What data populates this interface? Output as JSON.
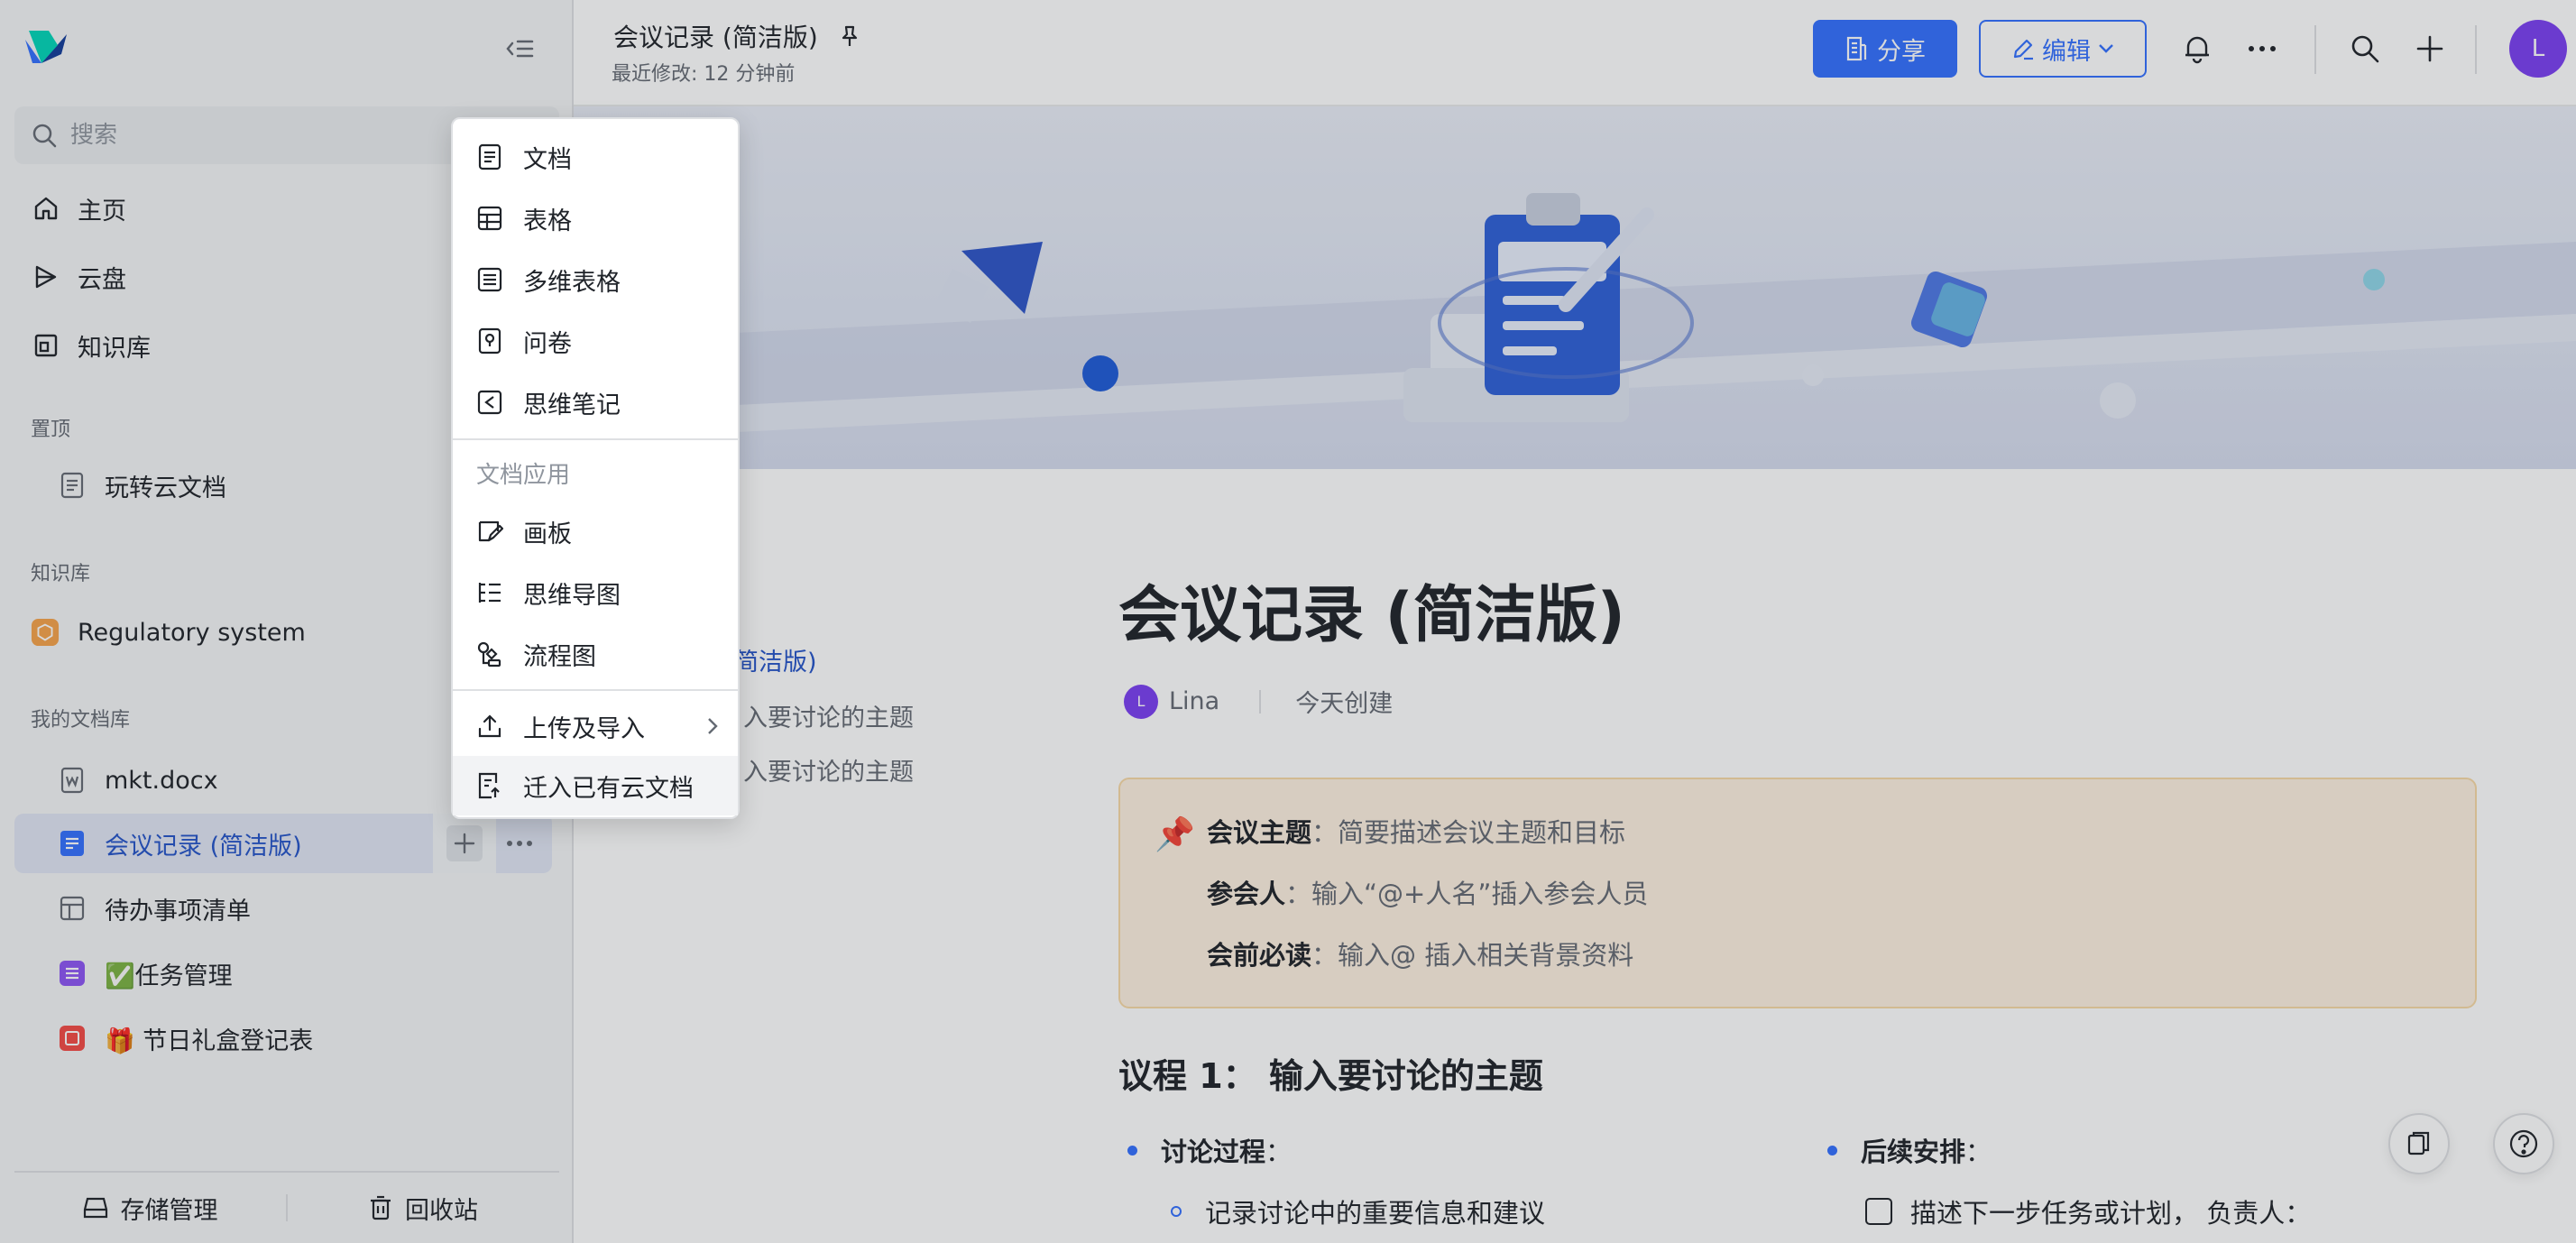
{
  "sidebar": {
    "search_placeholder": "搜索",
    "nav": [
      {
        "label": "主页",
        "icon": "home-icon"
      },
      {
        "label": "云盘",
        "icon": "cloud-drive-icon"
      },
      {
        "label": "知识库",
        "icon": "knowledge-base-icon"
      }
    ],
    "sections": {
      "pinned": "置顶",
      "knowledge": "知识库",
      "my_library": "我的文档库"
    },
    "pinned_items": [
      {
        "label": "玩转云文档",
        "icon": "doc-icon"
      }
    ],
    "knowledge_items": [
      {
        "label": "Regulatory system",
        "icon": "space-cube-icon"
      }
    ],
    "library_items": [
      {
        "label": "mkt.docx",
        "icon": "word-file-icon"
      },
      {
        "label": "会议记录 (简洁版)",
        "icon": "doc-blue-icon",
        "active": true
      },
      {
        "label": "待办事项清单",
        "icon": "sheet-icon"
      },
      {
        "label": "✅任务管理",
        "icon": "bitable-icon"
      },
      {
        "label": "🎁 节日礼盒登记表",
        "icon": "form-icon"
      }
    ],
    "footer": {
      "storage": "存储管理",
      "trash": "回收站"
    }
  },
  "header": {
    "title": "会议记录 (简洁版)",
    "subtitle": "最近修改: 12 分钟前",
    "share_label": "分享",
    "edit_label": "编辑",
    "avatar_initial": "L",
    "accent_color": "#3370ff"
  },
  "outline": {
    "items": [
      "简洁版)",
      "入要讨论的主题",
      "入要讨论的主题"
    ]
  },
  "document": {
    "title": "会议记录 (简洁版)",
    "author": "Lina",
    "author_initial": "L",
    "created": "今天创建",
    "callout": {
      "topic_label": "会议主题",
      "topic_value": "简要描述会议主题和目标",
      "attendee_label": "参会人",
      "attendee_value": "输入“@+人名”插入参会人员",
      "reading_label": "会前必读",
      "reading_value": "输入@ 插入相关背景资料"
    },
    "agenda_title": "议程 1： 输入要讨论的主题",
    "discussion_label": "讨论过程",
    "discussion_item": "记录讨论中的重要信息和建议",
    "followup_label": "后续安排",
    "followup_item": "描述下一步任务或计划， 负责人："
  },
  "menu": {
    "items": [
      {
        "label": "文档",
        "icon": "doc-icon"
      },
      {
        "label": "表格",
        "icon": "sheet-icon"
      },
      {
        "label": "多维表格",
        "icon": "bitable-icon"
      },
      {
        "label": "问卷",
        "icon": "survey-icon"
      },
      {
        "label": "思维笔记",
        "icon": "mind-note-icon"
      }
    ],
    "group_label": "文档应用",
    "app_items": [
      {
        "label": "画板",
        "icon": "whiteboard-icon"
      },
      {
        "label": "思维导图",
        "icon": "mindmap-icon"
      },
      {
        "label": "流程图",
        "icon": "flowchart-icon"
      }
    ],
    "upload_label": "上传及导入",
    "migrate_label": "迁入已有云文档"
  }
}
